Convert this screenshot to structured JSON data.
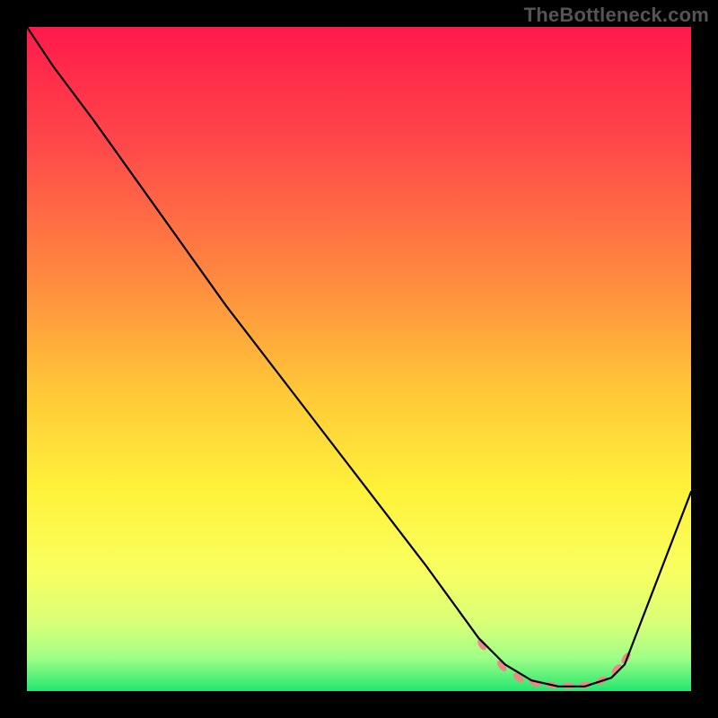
{
  "attribution": "TheBottleneck.com",
  "chart_data": {
    "type": "line",
    "title": "",
    "xlabel": "",
    "ylabel": "",
    "xlim": [
      0,
      100
    ],
    "ylim": [
      0,
      100
    ],
    "grid": false,
    "legend": false,
    "background_gradient": {
      "stops": [
        {
          "offset": 0.0,
          "color": "#ff1a4b"
        },
        {
          "offset": 0.18,
          "color": "#ff494a"
        },
        {
          "offset": 0.38,
          "color": "#ff8a3f"
        },
        {
          "offset": 0.55,
          "color": "#ffc838"
        },
        {
          "offset": 0.7,
          "color": "#fff23a"
        },
        {
          "offset": 0.82,
          "color": "#f9ff60"
        },
        {
          "offset": 0.9,
          "color": "#d7ff79"
        },
        {
          "offset": 0.95,
          "color": "#9fff86"
        },
        {
          "offset": 1.0,
          "color": "#24e66f"
        }
      ]
    },
    "series": [
      {
        "name": "curve",
        "color": "#000000",
        "stroke_width": 2.2,
        "x": [
          0,
          4,
          10,
          20,
          30,
          40,
          50,
          60,
          68,
          72,
          76,
          80,
          84,
          88,
          90,
          100
        ],
        "y": [
          100,
          94,
          86,
          72,
          58,
          45,
          32,
          19,
          8,
          4,
          1.6,
          0.7,
          0.7,
          2.0,
          4,
          30
        ]
      }
    ],
    "markers": {
      "name": "bottom-band",
      "color": "#e98b84",
      "x": [
        68.5,
        71.5,
        74,
        76.5,
        79,
        81.5,
        84,
        86.5,
        88.8,
        90.2
      ],
      "y": [
        7.0,
        3.8,
        2.0,
        1.2,
        0.9,
        0.8,
        0.9,
        1.6,
        3.3,
        5.0
      ],
      "angles": [
        58,
        52,
        40,
        24,
        10,
        0,
        -10,
        -28,
        -46,
        -55
      ],
      "rx": 7,
      "ry": 3.6
    }
  }
}
